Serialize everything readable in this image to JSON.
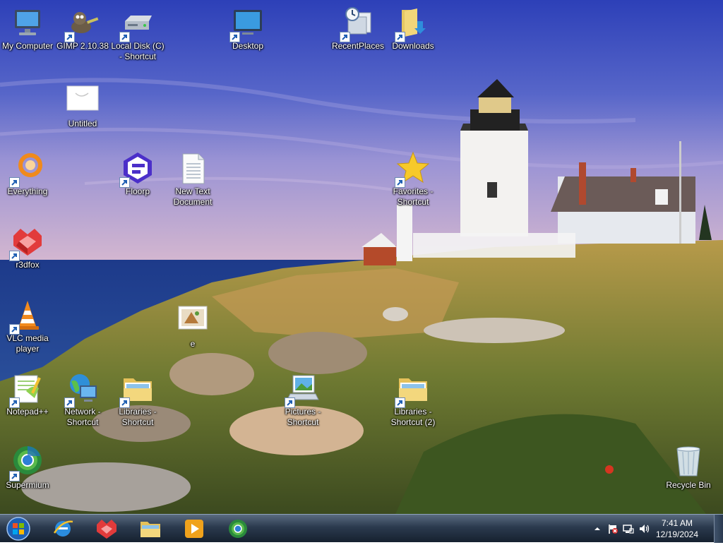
{
  "desktop_icons": [
    {
      "label": "My Computer",
      "icon": "computer-icon",
      "shortcut": false
    },
    {
      "label": "GIMP 2.10.38",
      "icon": "gimp-icon",
      "shortcut": true
    },
    {
      "label": "Local Disk (C) - Shortcut",
      "icon": "drive-icon",
      "shortcut": true
    },
    {
      "label": "Desktop",
      "icon": "desktop-icon",
      "shortcut": true
    },
    {
      "label": "RecentPlaces",
      "icon": "recent-places-icon",
      "shortcut": true
    },
    {
      "label": "Downloads",
      "icon": "downloads-folder-icon",
      "shortcut": true
    },
    {
      "label": "Untitled",
      "icon": "image-file-icon",
      "shortcut": false
    },
    {
      "label": "Everything",
      "icon": "everything-icon",
      "shortcut": true
    },
    {
      "label": "Floorp",
      "icon": "floorp-icon",
      "shortcut": true
    },
    {
      "label": "New Text Document",
      "icon": "text-document-icon",
      "shortcut": false
    },
    {
      "label": "Favorites - Shortcut",
      "icon": "star-icon",
      "shortcut": true
    },
    {
      "label": "r3dfox",
      "icon": "r3dfox-icon",
      "shortcut": true
    },
    {
      "label": "VLC media player",
      "icon": "vlc-icon",
      "shortcut": true
    },
    {
      "label": "e",
      "icon": "image-file-icon",
      "shortcut": false
    },
    {
      "label": "Notepad++",
      "icon": "notepadpp-icon",
      "shortcut": true
    },
    {
      "label": "Network - Shortcut",
      "icon": "network-icon",
      "shortcut": true
    },
    {
      "label": "Libraries - Shortcut",
      "icon": "libraries-folder-icon",
      "shortcut": true
    },
    {
      "label": "Pictures - Shortcut",
      "icon": "pictures-icon",
      "shortcut": true
    },
    {
      "label": "Libraries - Shortcut (2)",
      "icon": "libraries-folder-icon",
      "shortcut": true
    },
    {
      "label": "Supermium",
      "icon": "supermium-icon",
      "shortcut": true
    },
    {
      "label": "Recycle Bin",
      "icon": "recycle-bin-icon",
      "shortcut": false
    }
  ],
  "taskbar": {
    "start": "start-orb-icon",
    "pinned": [
      "internet-explorer-icon",
      "r3dfox-icon",
      "file-explorer-icon",
      "media-player-icon",
      "supermium-icon"
    ]
  },
  "tray": {
    "time": "7:41 AM",
    "date": "12/19/2024",
    "icons": [
      "show-hidden-icons-icon",
      "action-center-flag-icon",
      "network-status-icon",
      "volume-icon"
    ]
  },
  "colors": {
    "accent": "#1f5fb3",
    "taskbar": "#2b3a4e"
  }
}
